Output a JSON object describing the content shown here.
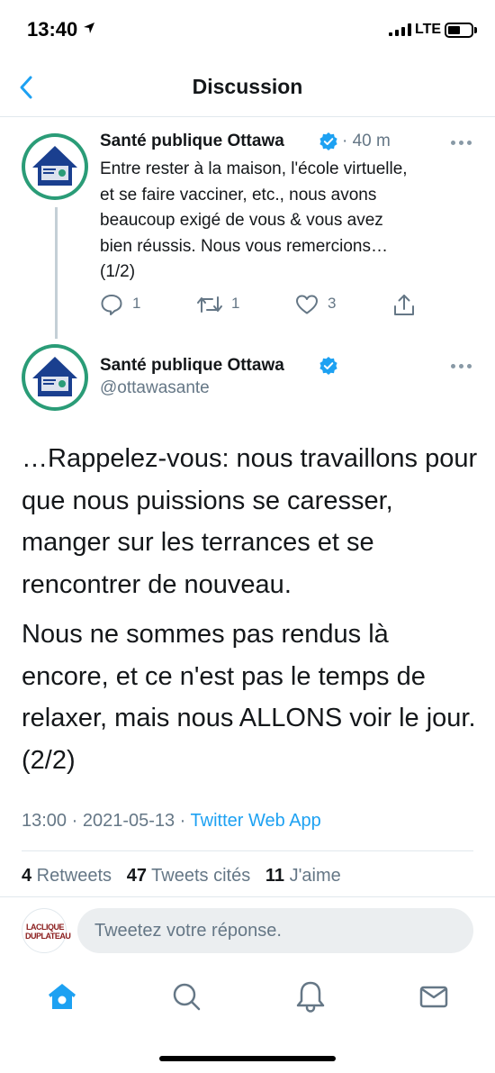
{
  "status_bar": {
    "time": "13:40",
    "network": "LTE"
  },
  "nav": {
    "title": "Discussion"
  },
  "tweet1": {
    "author_name": "Santé publique Ottawa",
    "time_ago": "· 40 m",
    "text": "Entre rester à la maison, l'école virtuelle,\net se faire vacciner, etc., nous avons\nbeaucoup exigé de vous & vous avez\nbien réussis. Nous vous remercions…\n(1/2)",
    "reply_count": "1",
    "retweet_count": "1",
    "like_count": "3"
  },
  "tweet2": {
    "author_name": "Santé publique Ottawa",
    "handle": "@ottawasante",
    "paragraph1": "…Rappelez-vous: nous travaillons pour que nous puissions se caresser, manger sur les terrances et se rencontrer de nouveau.",
    "paragraph2": "Nous ne sommes pas rendus là encore, et ce n'est pas le temps de relaxer, mais nous ALLONS voir le jour. (2/2)",
    "timestamp": "13:00 · 2021-05-13 · ",
    "app": "Twitter Web App",
    "stats": {
      "retweets_count": "4",
      "retweets_label": " Retweets",
      "quotes_count": "47",
      "quotes_label": " Tweets cités",
      "likes_count": "11",
      "likes_label": " J'aime"
    }
  },
  "reply": {
    "placeholder": "Tweetez votre réponse.",
    "avatar_text": "LACLIQUE DUPLATEAU"
  },
  "icons": {
    "back": "chevron-left-icon",
    "verified": "verified-badge-icon",
    "reply": "comment-icon",
    "retweet": "retweet-icon",
    "like": "heart-icon",
    "share": "share-icon",
    "home": "home-icon",
    "search": "search-icon",
    "notifications": "bell-icon",
    "messages": "envelope-icon"
  },
  "colors": {
    "accent": "#1da1f2",
    "text": "#14171a",
    "muted": "#657786",
    "avatar_ring": "#2a9c77",
    "avatar_house": "#1a3f8f"
  }
}
